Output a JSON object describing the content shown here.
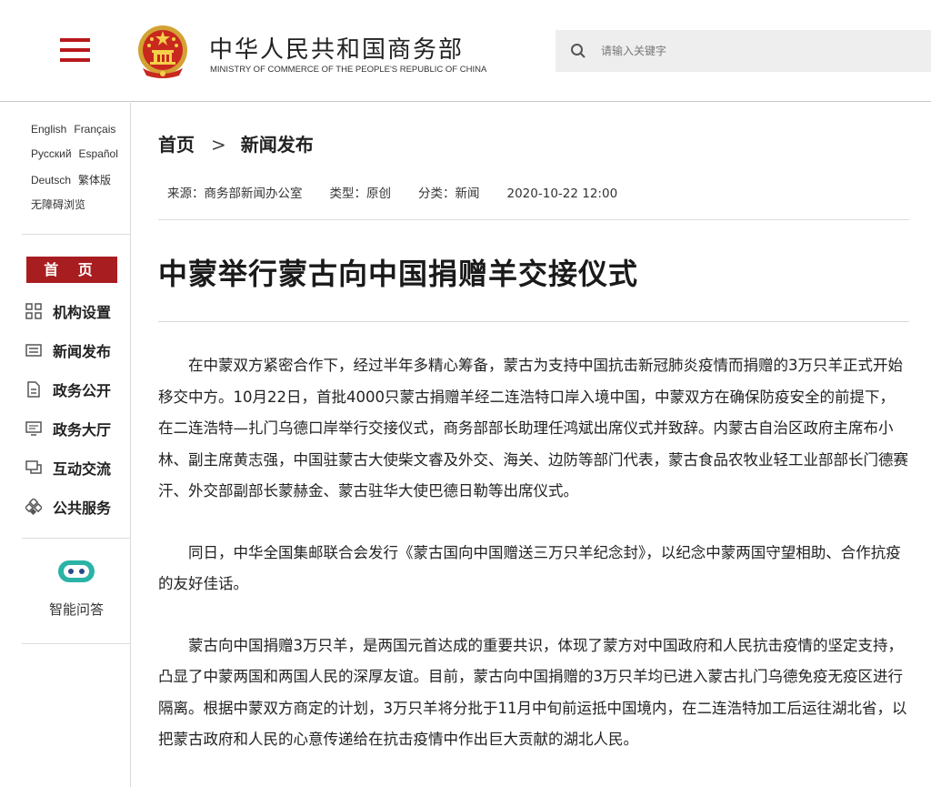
{
  "header": {
    "site_name_cn": "中华人民共和国商务部",
    "site_name_en": "MINISTRY OF COMMERCE OF THE PEOPLE'S REPUBLIC OF CHINA",
    "search_placeholder": "请输入关键字",
    "accent_color": "#b8181c"
  },
  "sidebar": {
    "languages": [
      "English",
      "Français",
      "Русский",
      "Español",
      "Deutsch",
      "繁体版",
      "无障碍浏览"
    ],
    "home_label": "首 页",
    "nav": [
      {
        "label": "机构设置",
        "icon": "grid-icon"
      },
      {
        "label": "新闻发布",
        "icon": "news-icon"
      },
      {
        "label": "政务公开",
        "icon": "document-icon"
      },
      {
        "label": "政务大厅",
        "icon": "monitor-icon"
      },
      {
        "label": "互动交流",
        "icon": "chat-icon"
      },
      {
        "label": "公共服务",
        "icon": "service-icon"
      }
    ],
    "qa_label": "智能问答"
  },
  "breadcrumb": {
    "home": "首页",
    "separator": ">",
    "current": "新闻发布"
  },
  "meta": {
    "source": "来源：商务部新闻办公室",
    "type": "类型：原创",
    "category": "分类：新闻",
    "date": "2020-10-22 12:00"
  },
  "article": {
    "title": "中蒙举行蒙古向中国捐赠羊交接仪式",
    "paragraphs": [
      "在中蒙双方紧密合作下，经过半年多精心筹备，蒙古为支持中国抗击新冠肺炎疫情而捐赠的3万只羊正式开始移交中方。10月22日，首批4000只蒙古捐赠羊经二连浩特口岸入境中国，中蒙双方在确保防疫安全的前提下，在二连浩特—扎门乌德口岸举行交接仪式，商务部部长助理任鸿斌出席仪式并致辞。内蒙古自治区政府主席布小林、副主席黄志强，中国驻蒙古大使柴文睿及外交、海关、边防等部门代表，蒙古食品农牧业轻工业部部长门德赛汗、外交部副部长蒙赫金、蒙古驻华大使巴德日勒等出席仪式。",
      "同日，中华全国集邮联合会发行《蒙古国向中国赠送三万只羊纪念封》，以纪念中蒙两国守望相助、合作抗疫的友好佳话。",
      "蒙古向中国捐赠3万只羊，是两国元首达成的重要共识，体现了蒙方对中国政府和人民抗击疫情的坚定支持，凸显了中蒙两国和两国人民的深厚友谊。目前，蒙古向中国捐赠的3万只羊均已进入蒙古扎门乌德免疫无疫区进行隔离。根据中蒙双方商定的计划，3万只羊将分批于11月中旬前运抵中国境内，在二连浩特加工后运往湖北省，以把蒙古政府和人民的心意传递给在抗击疫情中作出巨大贡献的湖北人民。"
    ]
  }
}
